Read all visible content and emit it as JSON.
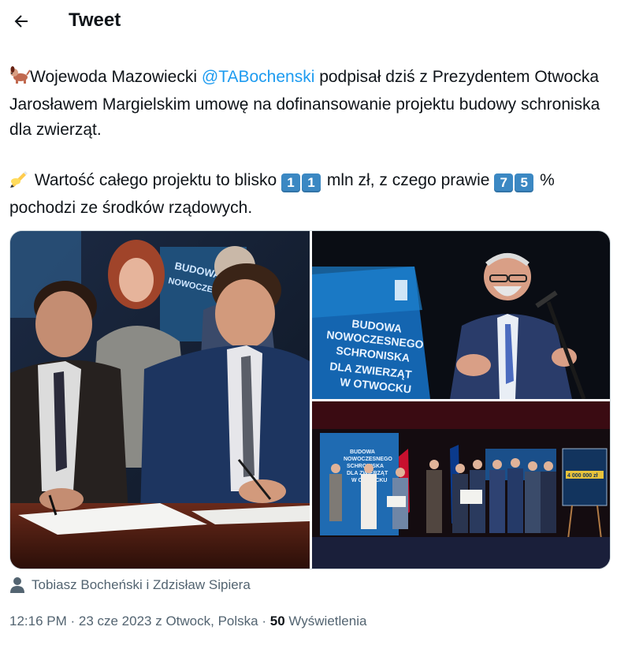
{
  "header": {
    "title": "Tweet",
    "back_icon": "arrow-left-icon"
  },
  "tweet": {
    "para1_emoji": "dog-emoji",
    "para1_before": "Wojewoda Mazowiecki ",
    "mention": "@TABochenski",
    "para1_after": " podpisał dziś z Prezydentem Otwocka Jarosławem Margielskim umowę na dofinansowanie projektu budowy schroniska dla zwierząt.",
    "para2_emoji": "writing-hand-emoji",
    "para2_a": " Wartość całego projektu to blisko ",
    "keycaps_1": [
      "1",
      "1"
    ],
    "para2_b": " mln zł, z czego prawie ",
    "keycaps_2": [
      "7",
      "5"
    ],
    "para2_c": " % pochodzi ze środków rządowych."
  },
  "media": {
    "photo1_text": "BUDOWA NOWOCZESNEGO",
    "photo2_text": [
      "BUDOWA",
      "NOWOCZESNEGO",
      "SCHRONISKA",
      "DLA ZWIERZĄT",
      "W OTWOCKU"
    ],
    "photo3_banner": [
      "BUDOWA",
      "NOWOCZESNEGO",
      "SCHRONISKA",
      "DLA ZWIERZĄT",
      "W OTWOCKU"
    ],
    "photo3_board_amount": "4 000 000 zł"
  },
  "tagged": {
    "icon": "person-icon",
    "text": "Tobiasz Bocheński i Zdzisław Sipiera"
  },
  "meta": {
    "time": "12:16 PM",
    "sep1": " · ",
    "date": "23 cze 2023",
    "location": " z Otwock, Polska",
    "sep2": " · ",
    "views_count": "50",
    "views_label": " Wyświetlenia"
  }
}
